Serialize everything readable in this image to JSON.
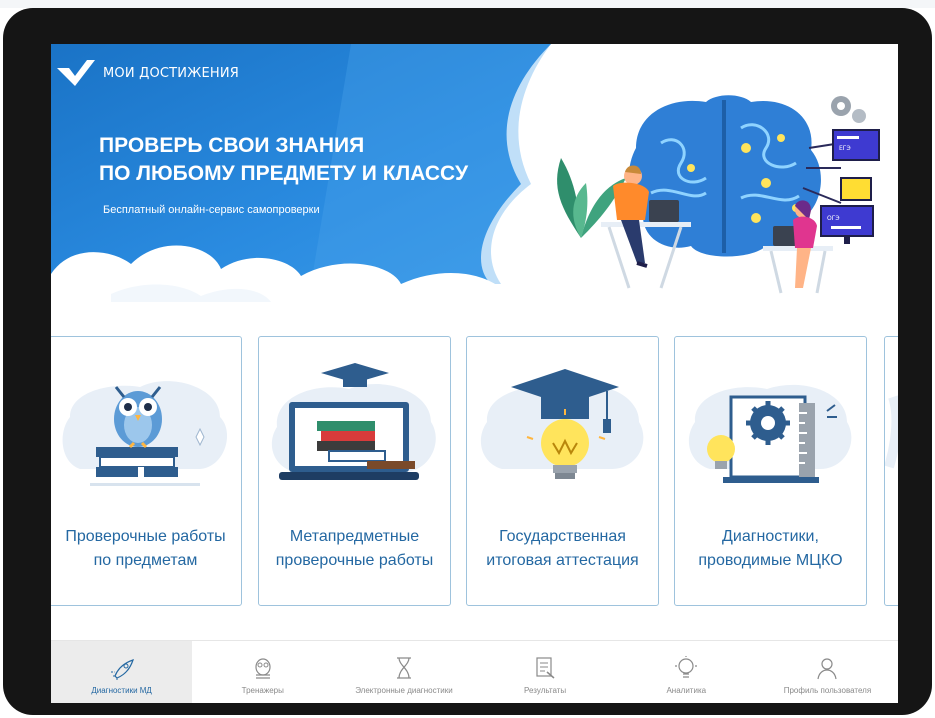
{
  "brand": {
    "name": "МОИ ДОСТИЖЕНИЯ"
  },
  "banner": {
    "headline_line1": "ПРОВЕРЬ СВОИ ЗНАНИЯ",
    "headline_line2": "ПО ЛЮБОМУ ПРЕДМЕТУ И КЛАССУ",
    "subtitle": "Бесплатный онлайн-сервис самопроверки",
    "screen_label_1": "ЕГЭ",
    "screen_label_2": "ОГЭ"
  },
  "cards": [
    {
      "line1": "Проверочные работы",
      "line2": "по предметам",
      "icon": "owl-books-icon"
    },
    {
      "line1": "Метапредметные",
      "line2": "проверочные работы",
      "icon": "laptop-books-icon"
    },
    {
      "line1": "Государственная",
      "line2": "итоговая аттестация",
      "icon": "graduation-bulb-icon"
    },
    {
      "line1": "Диагностики,",
      "line2": "проводимые МЦКО",
      "icon": "gear-ruler-icon"
    },
    {
      "line1": "",
      "line2": "г",
      "icon": "partial-card"
    }
  ],
  "nav": [
    {
      "label": "Диагностики МД",
      "icon": "rocket-icon",
      "active": true
    },
    {
      "label": "Тренажеры",
      "icon": "owl-icon",
      "active": false
    },
    {
      "label": "Электронные диагностики",
      "icon": "hourglass-icon",
      "active": false
    },
    {
      "label": "Результаты",
      "icon": "document-icon",
      "active": false
    },
    {
      "label": "Аналитика",
      "icon": "lightbulb-icon",
      "active": false
    },
    {
      "label": "Профиль пользователя",
      "icon": "user-icon",
      "active": false
    }
  ],
  "colors": {
    "banner_blue": "#1f7fd0",
    "accent_text": "#2468a2",
    "nav_active_bg": "#ececec"
  }
}
